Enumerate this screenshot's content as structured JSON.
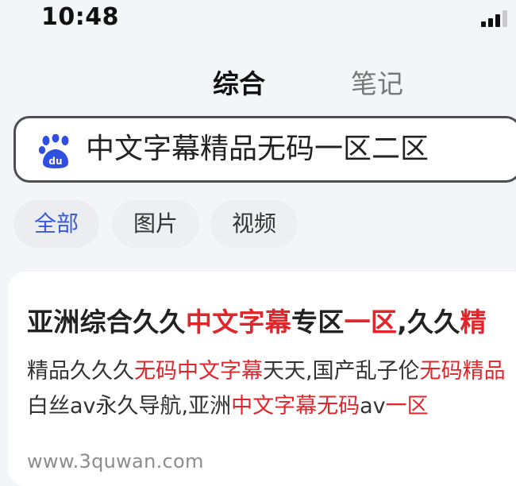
{
  "status_bar": {
    "time": "10:48",
    "signal_icon": "cellular-signal-icon"
  },
  "top_tabs": [
    {
      "label": "综合",
      "active": true
    },
    {
      "label": "笔记",
      "active": false
    }
  ],
  "search": {
    "icon": "baidu-paw-icon",
    "query": "中文字幕精品无码一区二区"
  },
  "filter_tabs": [
    {
      "label": "全部",
      "active": true
    },
    {
      "label": "图片",
      "active": false
    },
    {
      "label": "视频",
      "active": false
    }
  ],
  "result": {
    "title": [
      {
        "text": "亚洲综合久久",
        "highlight": false
      },
      {
        "text": "中文字幕",
        "highlight": true
      },
      {
        "text": "专区",
        "highlight": false
      },
      {
        "text": "一区",
        "highlight": true
      },
      {
        "text": ",久久",
        "highlight": false
      },
      {
        "text": "精",
        "highlight": true
      }
    ],
    "desc_line1": [
      {
        "text": "精品久久久",
        "highlight": false
      },
      {
        "text": "无码中文字幕",
        "highlight": true
      },
      {
        "text": "天天,国产乱子伦",
        "highlight": false
      },
      {
        "text": "无码精品",
        "highlight": true
      }
    ],
    "desc_line2": [
      {
        "text": "白丝av永久导航,亚洲",
        "highlight": false
      },
      {
        "text": "中文字幕无码",
        "highlight": true
      },
      {
        "text": "av",
        "highlight": false
      },
      {
        "text": "一区",
        "highlight": true
      }
    ],
    "url": "www.3quwan.com"
  },
  "colors": {
    "highlight": "#e0262a",
    "active_filter": "#3a5ad9",
    "baidu_blue": "#2e4fe0"
  }
}
